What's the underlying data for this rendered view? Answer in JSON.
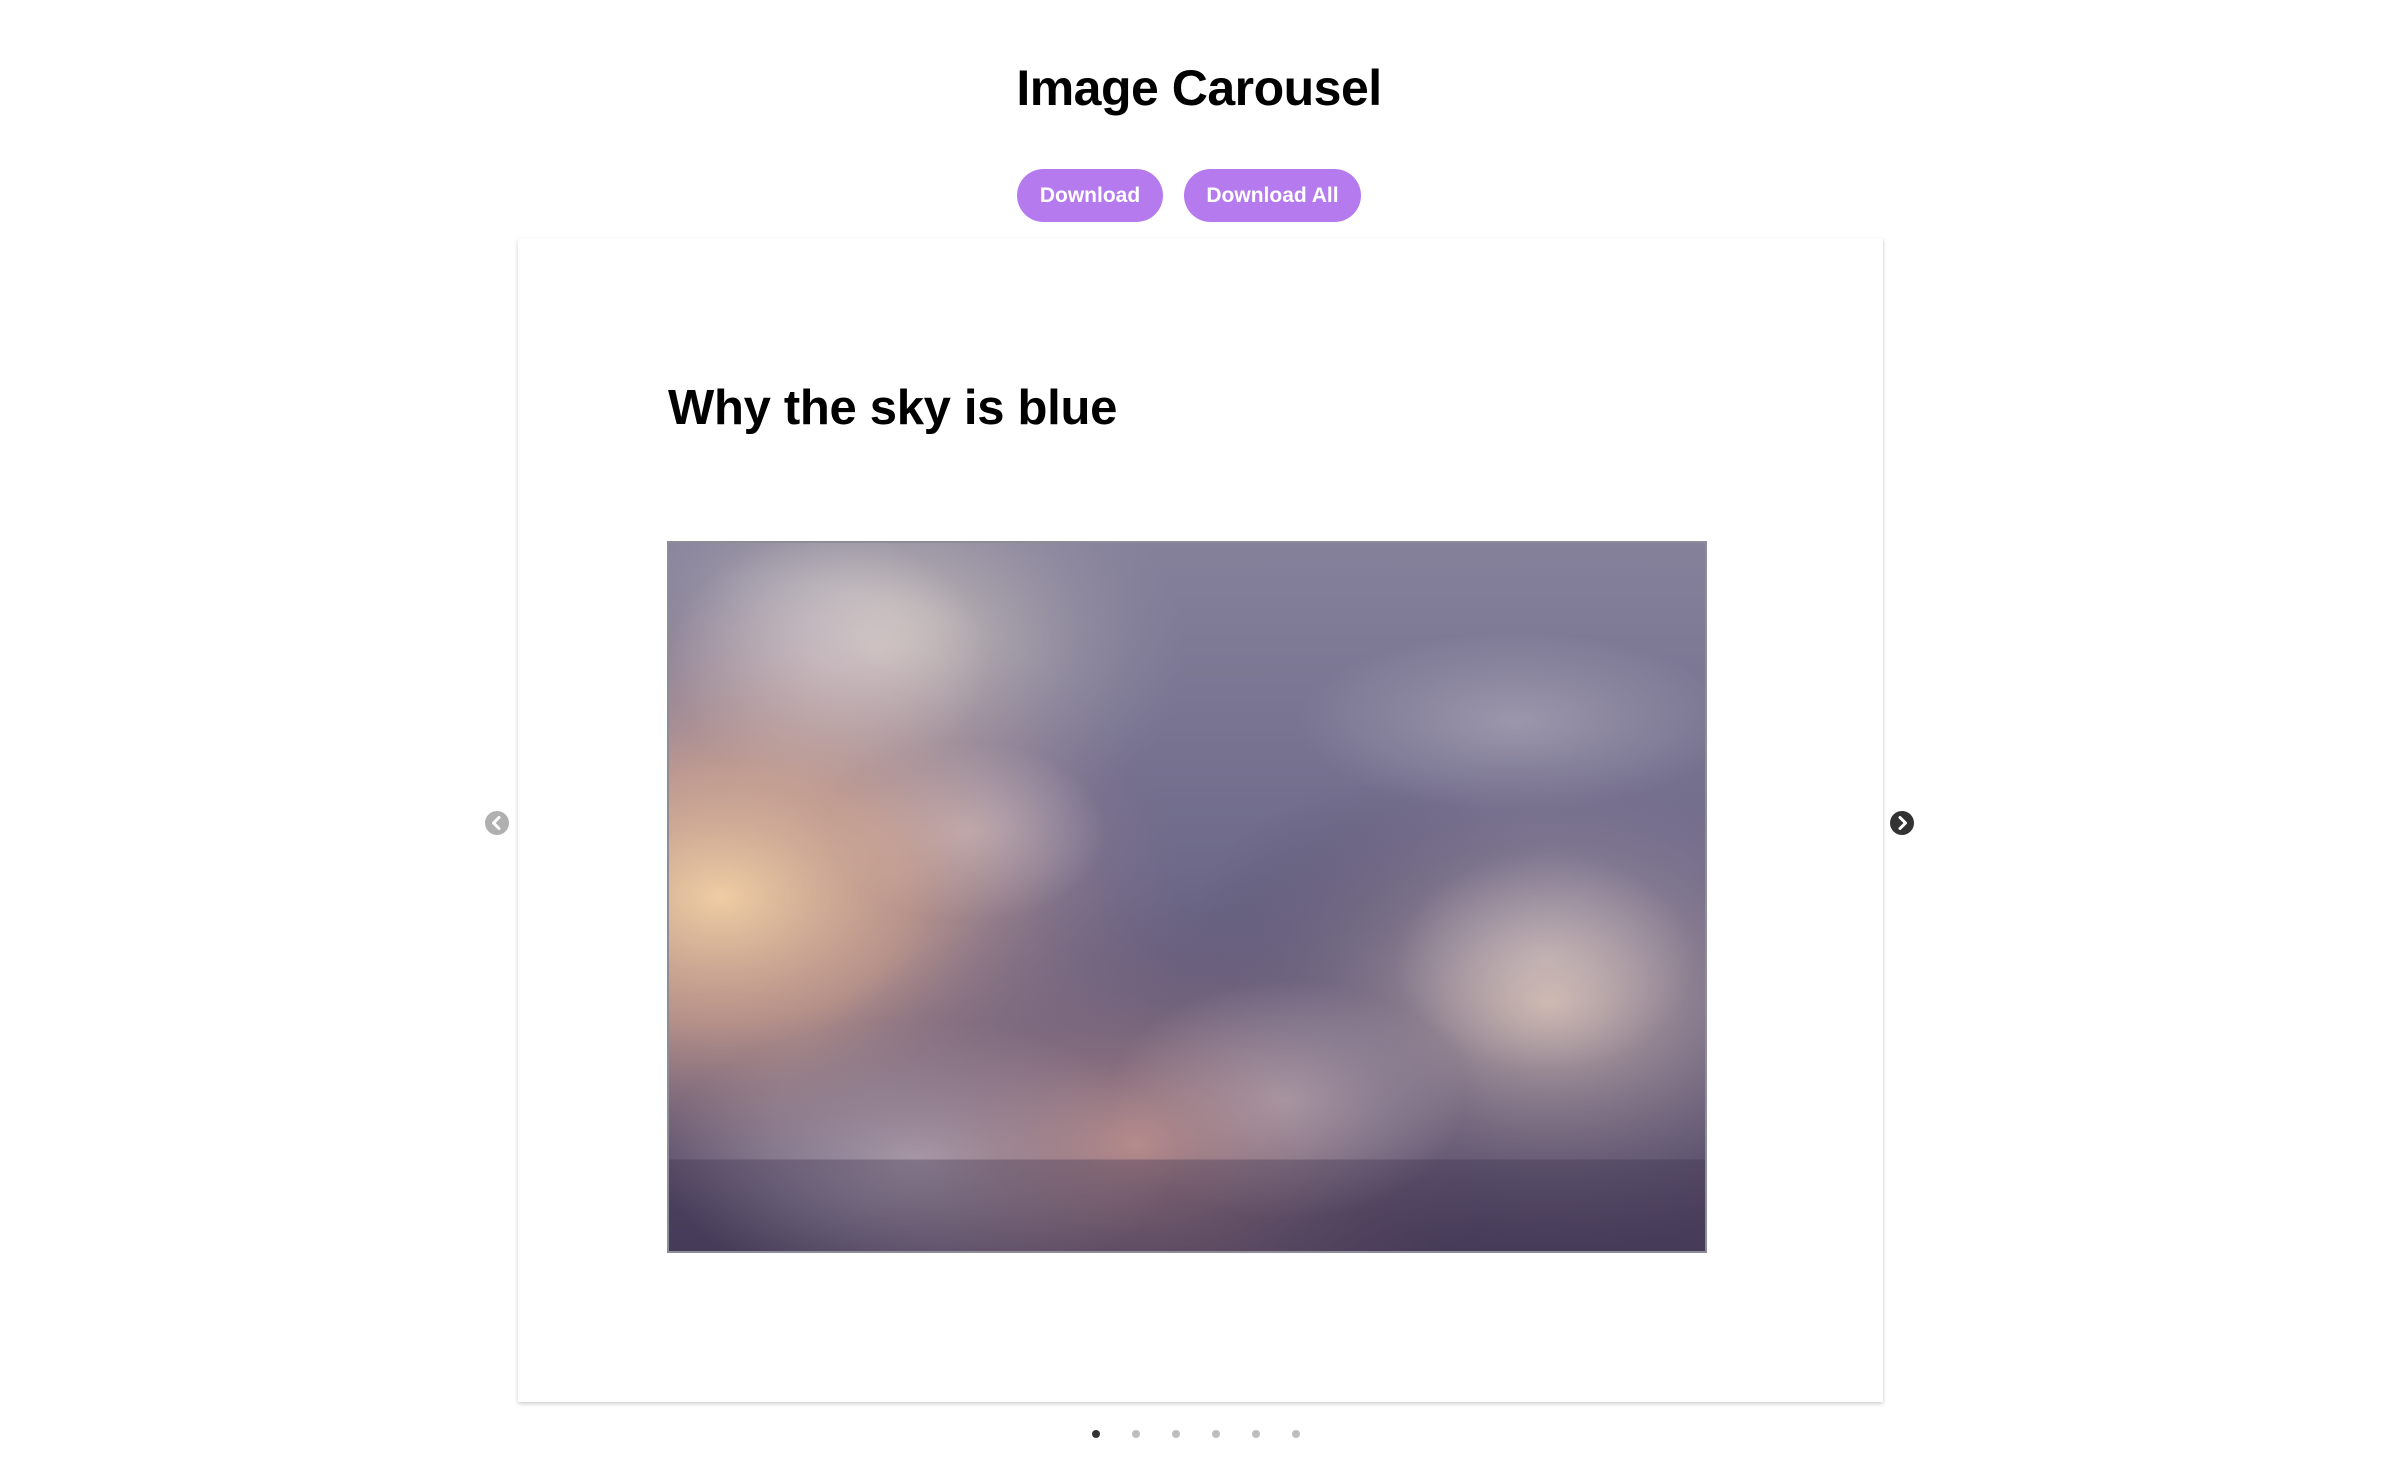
{
  "header": {
    "title": "Image Carousel"
  },
  "toolbar": {
    "download_label": "Download",
    "download_all_label": "Download All"
  },
  "carousel": {
    "slide_title": "Why the sky is blue",
    "image_alt_icon": "clouds-image",
    "prev_icon": "chevron-left-circle-icon",
    "next_icon": "chevron-right-circle-icon",
    "slide_count": 6,
    "active_index": 0
  },
  "colors": {
    "button_bg": "#b57bee",
    "button_text": "#ffffff",
    "dot_active": "#333333",
    "dot_inactive": "#bdbdbd",
    "prev_arrow": "#b0b0b0",
    "next_arrow": "#333333"
  }
}
